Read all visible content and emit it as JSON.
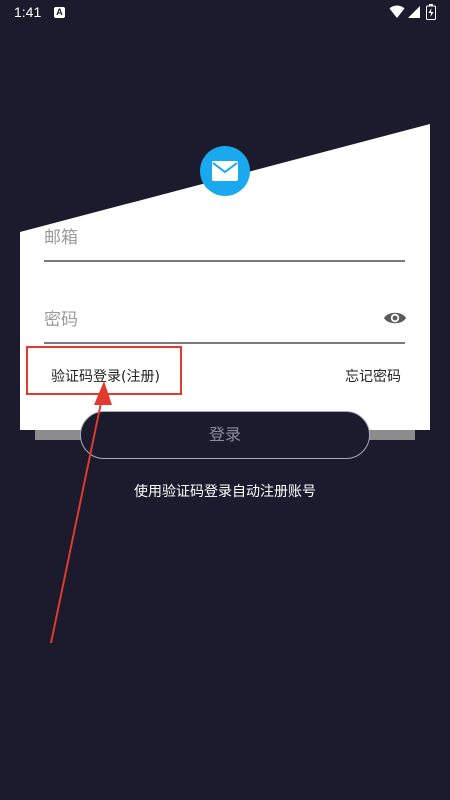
{
  "status_bar": {
    "time": "1:41",
    "notification_glyph": "A"
  },
  "form": {
    "email_placeholder": "邮箱",
    "password_placeholder": "密码",
    "code_login_label": "验证码登录(注册)",
    "forgot_password_label": "忘记密码",
    "login_label": "登录",
    "register_hint": "使用验证码登录自动注册账号"
  },
  "colors": {
    "accent": "#1aa8ee",
    "background": "#1b1b2d",
    "highlight": "#e23a2f"
  },
  "icons": [
    "wifi-icon",
    "signal-icon",
    "battery-icon",
    "mail-icon",
    "eye-icon"
  ]
}
